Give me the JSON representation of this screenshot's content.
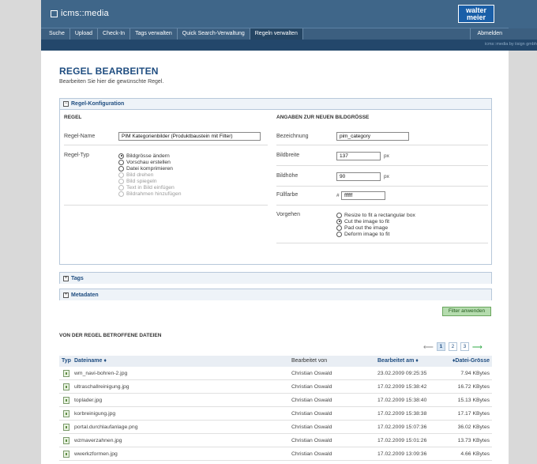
{
  "app": {
    "brand": "icms::media",
    "logo": "walter meier",
    "credit": "icms::media by iisign gmbh"
  },
  "nav": {
    "items": [
      "Suche",
      "Upload",
      "Check-In",
      "Tags verwalten",
      "Quick Search-Verwaltung",
      "Regeln verwalten"
    ],
    "active": "Regeln verwalten",
    "logout": "Abmelden"
  },
  "page": {
    "title": "REGEL BEARBEITEN",
    "subtitle": "Bearbeiten Sie hier die gewünschte Regel."
  },
  "config": {
    "header": "Regel-Konfiguration",
    "regel": {
      "section": "REGEL",
      "name_label": "Regel-Name",
      "name_value": "PIM Kategorienbilder (Produktbaustein mit Filter)",
      "type_label": "Regel-Typ",
      "types": [
        {
          "label": "Bildgrösse ändern",
          "checked": true,
          "disabled": false
        },
        {
          "label": "Vorschau erstellen",
          "checked": false,
          "disabled": false
        },
        {
          "label": "Datei komprimieren",
          "checked": false,
          "disabled": false
        },
        {
          "label": "Bild drehen",
          "checked": false,
          "disabled": true
        },
        {
          "label": "Bild spiegeln",
          "checked": false,
          "disabled": true
        },
        {
          "label": "Text in Bild einfügen",
          "checked": false,
          "disabled": true
        },
        {
          "label": "Bildrahmen hinzufügen",
          "checked": false,
          "disabled": true
        }
      ]
    },
    "bild": {
      "section": "ANGABEN ZUR NEUEN BILDGRÖSSE",
      "bezeichnung_label": "Bezeichnung",
      "bezeichnung_value": "pim_category",
      "breite_label": "Bildbreite",
      "breite_value": "137",
      "breite_unit": "px",
      "hoehe_label": "Bildhöhe",
      "hoehe_value": "90",
      "hoehe_unit": "px",
      "fuell_label": "Füllfarbe",
      "fuell_prefix": "#",
      "fuell_value": "ffffff",
      "vorgehen_label": "Vorgehen",
      "vorgehen": [
        {
          "label": "Resize to fit a rectangular box",
          "checked": false
        },
        {
          "label": "Cut the image to fit",
          "checked": true
        },
        {
          "label": "Pad out the image",
          "checked": false
        },
        {
          "label": "Deform image to fit",
          "checked": false
        }
      ]
    }
  },
  "tags_header": "Tags",
  "meta_header": "Metadaten",
  "filter_button": "Filter anwenden",
  "files": {
    "title": "VON DER REGEL BETROFFENE DATEIEN",
    "pages": [
      "1",
      "2",
      "3"
    ],
    "active_page": "1",
    "columns": {
      "typ": "Typ",
      "name": "Dateiname ♦",
      "by": "Bearbeitet von",
      "date": "Bearbeitet am ♦",
      "size": "♦Datei-Grösse"
    },
    "rows": [
      {
        "name": "wm_navi-bohren-2.jpg",
        "by": "Christian Oswald",
        "date": "23.02.2009 09:25:35",
        "size": "7.94 KBytes"
      },
      {
        "name": "ultraschallreinigung.jpg",
        "by": "Christian Oswald",
        "date": "17.02.2009 15:38:42",
        "size": "16.72 KBytes"
      },
      {
        "name": "toplader.jpg",
        "by": "Christian Oswald",
        "date": "17.02.2009 15:38:40",
        "size": "15.13 KBytes"
      },
      {
        "name": "korbreinigung.jpg",
        "by": "Christian Oswald",
        "date": "17.02.2009 15:38:38",
        "size": "17.17 KBytes"
      },
      {
        "name": "portal.durchlaufanlage.png",
        "by": "Christian Oswald",
        "date": "17.02.2009 15:07:36",
        "size": "36.02 KBytes"
      },
      {
        "name": "wzmaverzahnen.jpg",
        "by": "Christian Oswald",
        "date": "17.02.2009 15:01:26",
        "size": "13.73 KBytes"
      },
      {
        "name": "wwerkzformen.jpg",
        "by": "Christian Oswald",
        "date": "17.02.2009 13:09:36",
        "size": "4.66 KBytes"
      }
    ]
  }
}
